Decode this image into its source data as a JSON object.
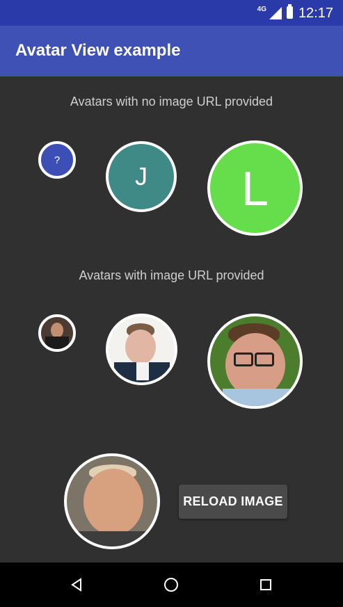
{
  "status_bar": {
    "network": "4G",
    "time": "12:17"
  },
  "app_bar": {
    "title": "Avatar View example"
  },
  "sections": {
    "no_image_title": "Avatars with no image URL provided",
    "with_image_title": "Avatars with image URL provided"
  },
  "avatars": {
    "small_initial": "?",
    "medium_initial": "J",
    "large_initial": "L"
  },
  "button": {
    "reload_label": "RELOAD IMAGE"
  },
  "icons": {
    "signal": "signal-icon",
    "battery": "battery-icon",
    "back": "back-icon",
    "home": "home-icon",
    "recent": "recent-apps-icon"
  }
}
